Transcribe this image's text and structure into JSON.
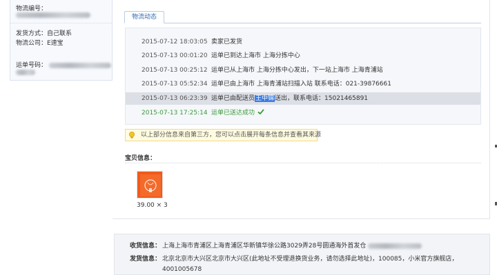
{
  "left_panel": {
    "order_no_label": "物流编号：",
    "ship_method": "发货方式：自己联系",
    "logistics_company": "物流公司：E速宝",
    "waybill_label": "运单号码："
  },
  "tab": {
    "label": "物流动态"
  },
  "log": [
    {
      "time": "2015-07-12 18:03:05",
      "text": "卖家已发货"
    },
    {
      "time": "2015-07-13 00:01:20",
      "text": "运单已到达上海市 上海分拣中心"
    },
    {
      "time": "2015-07-13 00:25:12",
      "text": "运单已从上海市 上海分拣中心发出，下一站上海市 上海青浦站"
    },
    {
      "time": "2015-07-13 05:52:34",
      "text": "运单已由上海市 上海青浦站扫描入站 联系电话：021-39876661"
    },
    {
      "time": "2015-07-13 06:23:39",
      "text_pre": "运单已由配送员",
      "text_sel": "王中锦",
      "text_post": "送出，联系电话：15021465891"
    },
    {
      "time": "2015-07-13 17:25:14",
      "text": "运单已送达成功"
    }
  ],
  "tip": {
    "text": "以上部分信息来自第三方，您可以点击展开每条信息并查看其来源"
  },
  "item_section": {
    "title": "宝贝信息：",
    "price": "39.00 × 3"
  },
  "address": {
    "receive_label": "收货信息：",
    "receive_value": "上海上海市青浦区上海青浦区华新镇华徐公路3029弄28号圆通海外首发仓",
    "ship_label": "发货信息：",
    "ship_value": "北京北京市大兴区北京市大兴区(此地址不受理退换货业务，请勿选择此地址)，100085，小米官方旗舰店，",
    "ship_phone": "4001005678"
  },
  "colors": {
    "link_blue": "#2e6bb0",
    "success_green": "#3a9a3a",
    "highlight": "#3b7de0",
    "thumb_orange": "#f05a1c"
  },
  "icons": {
    "tip": "lightbulb-icon",
    "done": "check-icon"
  }
}
